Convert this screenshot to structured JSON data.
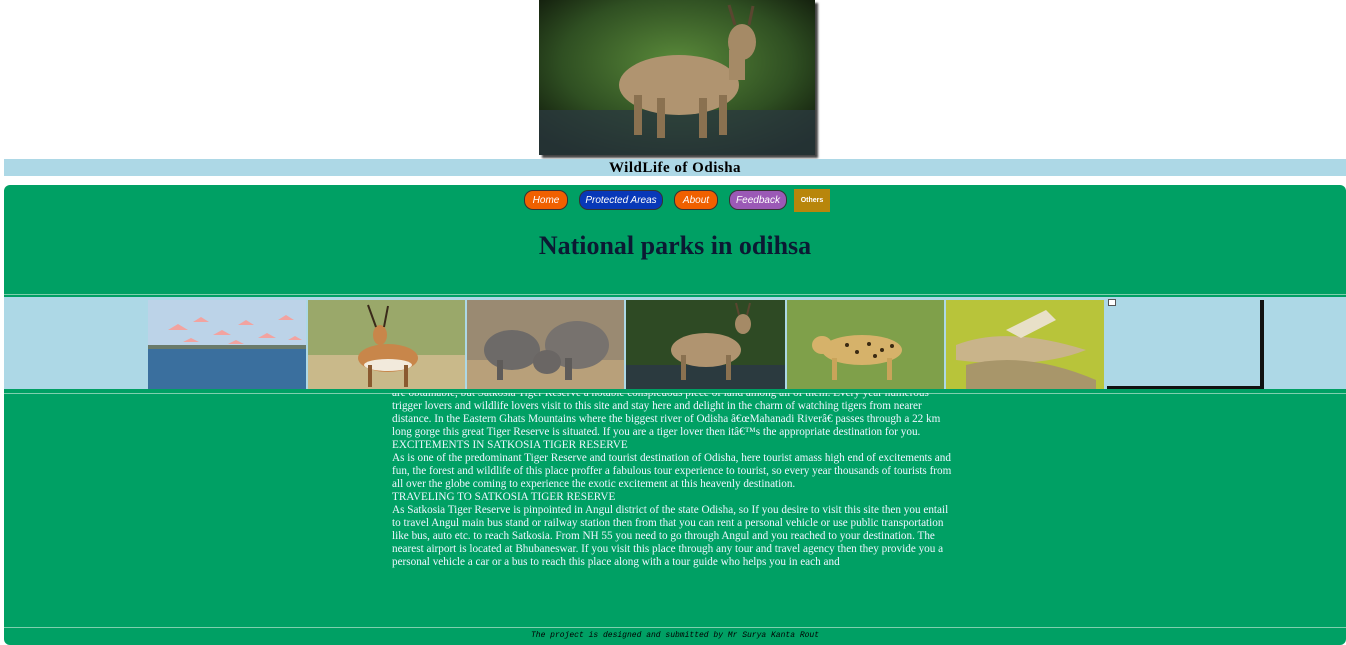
{
  "site": {
    "title": "WildLife of Odisha"
  },
  "nav": {
    "items": [
      {
        "label": "Home"
      },
      {
        "label": "Protected Areas"
      },
      {
        "label": "About"
      },
      {
        "label": "Feedback"
      },
      {
        "label": "Others"
      }
    ]
  },
  "page": {
    "heading": "National parks in odihsa"
  },
  "gallery": {
    "images": [
      {
        "icon": "flamingos-photo"
      },
      {
        "icon": "antelope-photo"
      },
      {
        "icon": "elephants-photo"
      },
      {
        "icon": "deer-photo"
      },
      {
        "icon": "leopard-photo"
      },
      {
        "icon": "crocodile-photo"
      },
      {
        "icon": "broken-image-icon"
      }
    ]
  },
  "article": {
    "paragraphs": [
      "are obtainable, but Satkosia Tiger Reserve a notable conspicuous piece of land among all of them. Every year numerous trigger lovers and wildlife lovers visit to this site and stay here and delight in the charm of watching tigers from nearer distance. In the Eastern Ghats Mountains where the biggest river of Odisha â€œMahanadi Riverâ€ passes through a 22 km long gorge this great Tiger Reserve is situated. If you are a tiger lover then itâ€™s the appropriate destination for you.",
      "EXCITEMENTS IN SATKOSIA TIGER RESERVE",
      "As is one of the predominant Tiger Reserve and tourist destination of Odisha, here tourist amass high end of excitements and fun, the forest and wildlife of this place proffer a fabulous tour experience to tourist, so every year thousands of tourists from all over the globe coming to experience the exotic excitement at this heavenly destination.",
      "TRAVELING TO SATKOSIA TIGER RESERVE",
      "As Satkosia Tiger Reserve is pinpointed in Angul district of the state Odisha, so If you desire to visit this site then you entail to travel Angul main bus stand or railway station then from that you can rent a personal vehicle or use public transportation like bus, auto etc. to reach Satkosia. From NH 55 you need to go through Angul and you reached to your destination. The nearest airport is located at Bhubaneswar. If you visit this place through any tour and travel agency then they provide you a personal vehicle a car or a bus to reach this place along with a tour guide who helps you in each and"
    ]
  },
  "footer": {
    "text": "The project is designed and submitted by Mr Surya Kanta Rout"
  },
  "colors": {
    "panel": "#00a064",
    "title_bar": "#add8e6",
    "home_button": "#f06000",
    "protected_button": "#0838b8",
    "feedback_button": "#9b59b6",
    "others_button": "#b8860b"
  }
}
